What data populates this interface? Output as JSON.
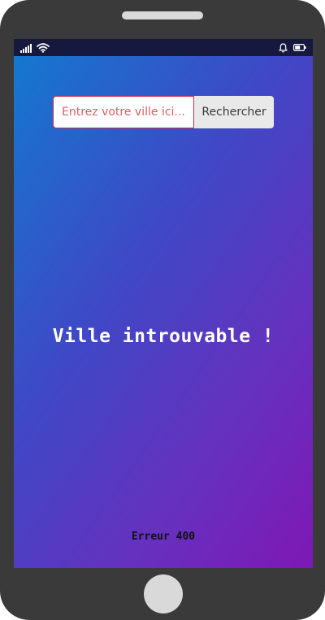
{
  "status_bar": {
    "icons": [
      "signal-icon",
      "wifi-icon",
      "bell-icon",
      "battery-icon"
    ]
  },
  "search": {
    "placeholder": "Entrez votre ville ici...",
    "value": "",
    "button_label": "Rechercher"
  },
  "result": {
    "message": "Ville introuvable !",
    "error_code": "Erreur 400"
  },
  "colors": {
    "phone_frame": "#3a3a3a",
    "status_bar": "#16183d",
    "gradient_start": "#1478cf",
    "gradient_end": "#7e18b4",
    "input_border": "#d92a3a",
    "placeholder": "#e05c63"
  }
}
